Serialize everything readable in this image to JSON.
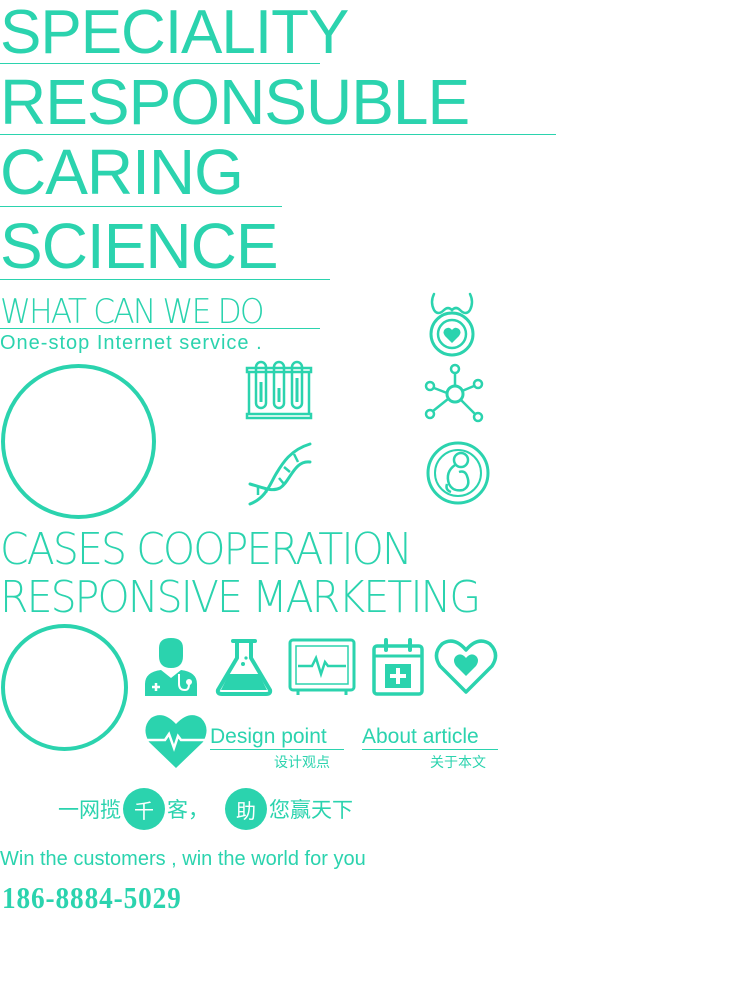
{
  "headline": {
    "line1": "SPECIALITY",
    "line2": "RESPONSUBLE",
    "line3": "CARING",
    "line4": "SCIENCE"
  },
  "services": {
    "title": "WHAT CAN WE DO",
    "subtitle": "One-stop Internet service ."
  },
  "cases": {
    "line1": "CASES  COOPERATION",
    "line2": "RESPONSIVE  MARKETING"
  },
  "links": {
    "design_point_en": "Design point",
    "design_point_cn": "设计观点",
    "about_article_en": "About article",
    "about_article_cn": "关于本文"
  },
  "slogan": {
    "cn_part1": "一网揽",
    "cn_badge1": "千",
    "cn_part2": "客，",
    "cn_badge2": "助",
    "cn_part3": "您赢天下",
    "en": "Win the customers , win the world for you"
  },
  "contact": {
    "phone": "186-8884-5029"
  },
  "icons": [
    "pregnancy-heart-icon",
    "test-tubes-icon",
    "molecule-icon",
    "dna-icon",
    "fetus-icon",
    "doctor-icon",
    "flask-icon",
    "heart-monitor-icon",
    "medical-calendar-icon",
    "heart-outline-icon",
    "heartbeat-heart-icon"
  ],
  "colors": {
    "accent": "#2BD3AE",
    "background": "#FFFFFF"
  }
}
